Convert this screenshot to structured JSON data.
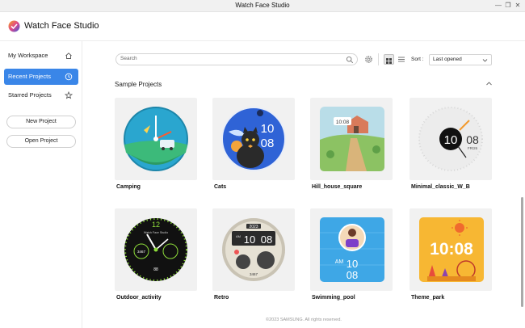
{
  "window": {
    "title": "Watch Face Studio",
    "minimize_glyph": "—",
    "maximize_glyph": "❐",
    "close_glyph": "✕"
  },
  "app": {
    "name": "Watch Face Studio",
    "logo_icon": "watch-face-studio-logo"
  },
  "sidebar": {
    "items": [
      {
        "label": "My Workspace",
        "icon": "home-icon",
        "active": false
      },
      {
        "label": "Recent Projects",
        "icon": "clock-icon",
        "active": true
      },
      {
        "label": "Starred Projects",
        "icon": "star-icon",
        "active": false
      }
    ],
    "buttons": {
      "new_project": "New Project",
      "open_project": "Open Project"
    }
  },
  "toolbar": {
    "search_placeholder": "Search",
    "sort_label": "Sort :",
    "sort_value": "Last opened",
    "view_mode": "grid"
  },
  "section": {
    "title": "Sample Projects",
    "expanded": true
  },
  "projects": [
    {
      "name": "Camping"
    },
    {
      "name": "Cats",
      "time_hour": "10",
      "time_min": "08"
    },
    {
      "name": "Hill_house_square",
      "time": "10:08"
    },
    {
      "name": "Minimal_classic_W_B",
      "time_hour": "10",
      "time_min": "08",
      "day": "FRI26"
    },
    {
      "name": "Outdoor_activity",
      "brand": "Watch Face Studio",
      "top_num": "12",
      "steps": "3467",
      "bpm": "88"
    },
    {
      "name": "Retro",
      "year": "2023",
      "hour": "10",
      "min": "08",
      "am": "AM",
      "steps": "3467"
    },
    {
      "name": "Swimming_pool",
      "am": "AM",
      "hour": "10",
      "min": "08"
    },
    {
      "name": "Theme_park",
      "time": "10:08"
    }
  ],
  "footer": {
    "text": "©2023 SAMSUNG. All rights reserved."
  },
  "colors": {
    "accent": "#3a86e8",
    "thumb_bg": "#f1f1f1"
  }
}
